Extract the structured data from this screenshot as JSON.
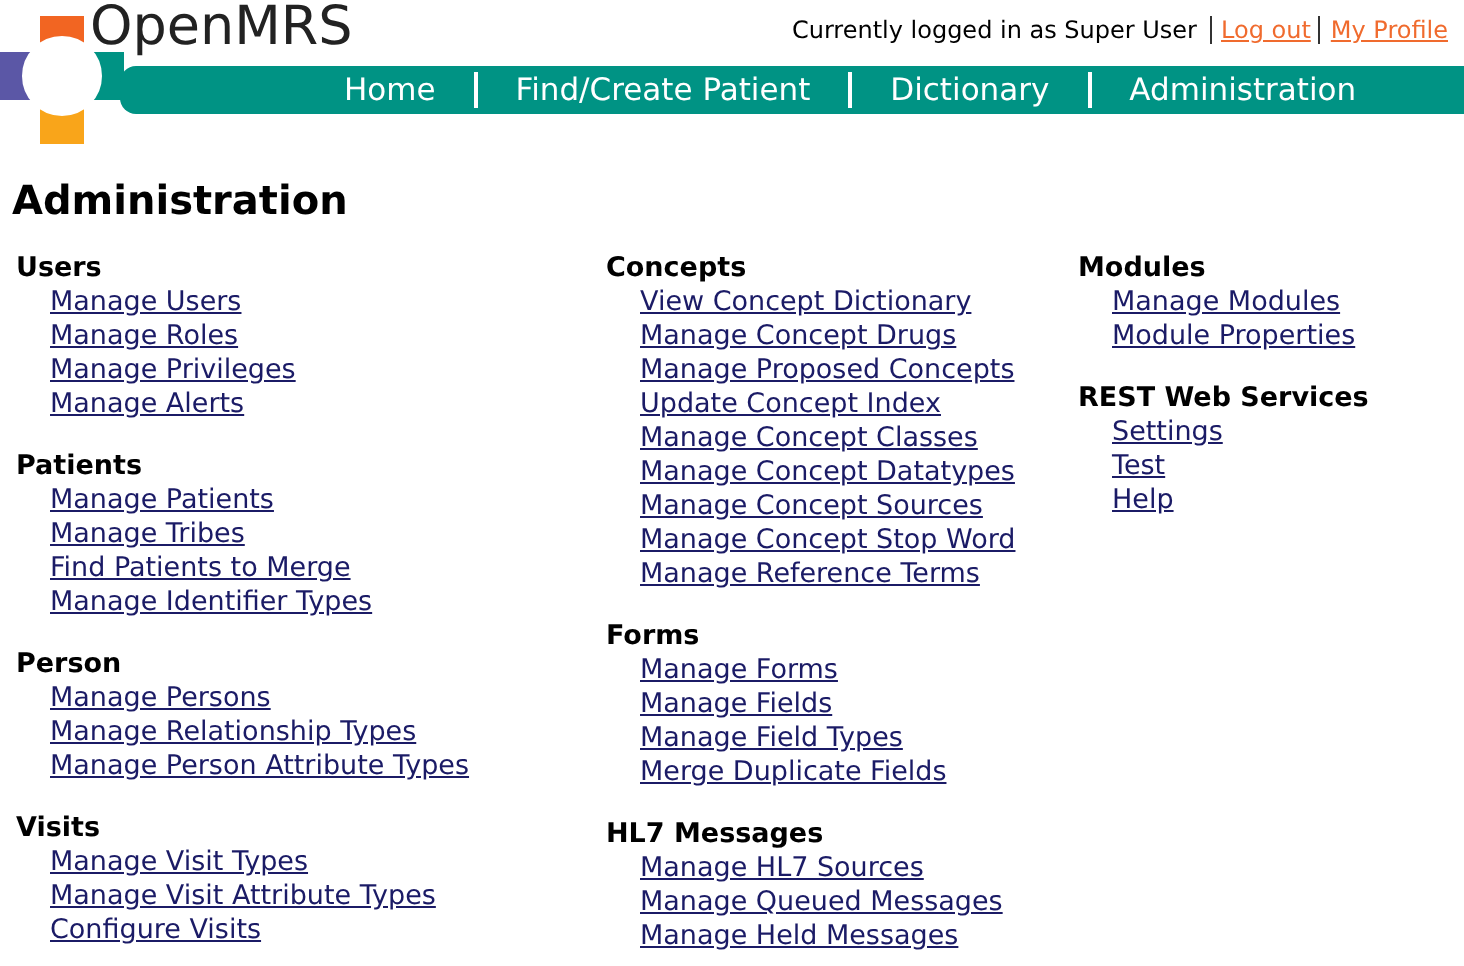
{
  "header": {
    "app_name": "OpenMRS",
    "login_text": "Currently logged in as Super User",
    "user_links": [
      "Log out",
      "My Profile"
    ]
  },
  "nav": [
    "Home",
    "Find/Create Patient",
    "Dictionary",
    "Administration"
  ],
  "page_title": "Administration",
  "columns": [
    [
      {
        "title": "Users",
        "links": [
          "Manage Users",
          "Manage Roles",
          "Manage Privileges",
          "Manage Alerts"
        ]
      },
      {
        "title": "Patients",
        "links": [
          "Manage Patients",
          "Manage Tribes",
          "Find Patients to Merge",
          "Manage Identifier Types"
        ]
      },
      {
        "title": "Person",
        "links": [
          "Manage Persons",
          "Manage Relationship Types",
          "Manage Person Attribute Types"
        ]
      },
      {
        "title": "Visits",
        "links": [
          "Manage Visit Types",
          "Manage Visit Attribute Types",
          "Configure Visits"
        ]
      }
    ],
    [
      {
        "title": "Concepts",
        "links": [
          "View Concept Dictionary",
          "Manage Concept Drugs",
          "Manage Proposed Concepts",
          "Update Concept Index",
          "Manage Concept Classes",
          "Manage Concept Datatypes",
          "Manage Concept Sources",
          "Manage Concept Stop Word",
          "Manage Reference Terms"
        ]
      },
      {
        "title": "Forms",
        "links": [
          "Manage Forms",
          "Manage Fields",
          "Manage Field Types",
          "Merge Duplicate Fields"
        ]
      },
      {
        "title": "HL7 Messages",
        "links": [
          "Manage HL7 Sources",
          "Manage Queued Messages",
          "Manage Held Messages"
        ]
      }
    ],
    [
      {
        "title": "Modules",
        "links": [
          "Manage Modules",
          "Module Properties"
        ]
      },
      {
        "title": "REST Web Services",
        "links": [
          "Settings",
          "Test",
          "Help"
        ]
      }
    ]
  ]
}
